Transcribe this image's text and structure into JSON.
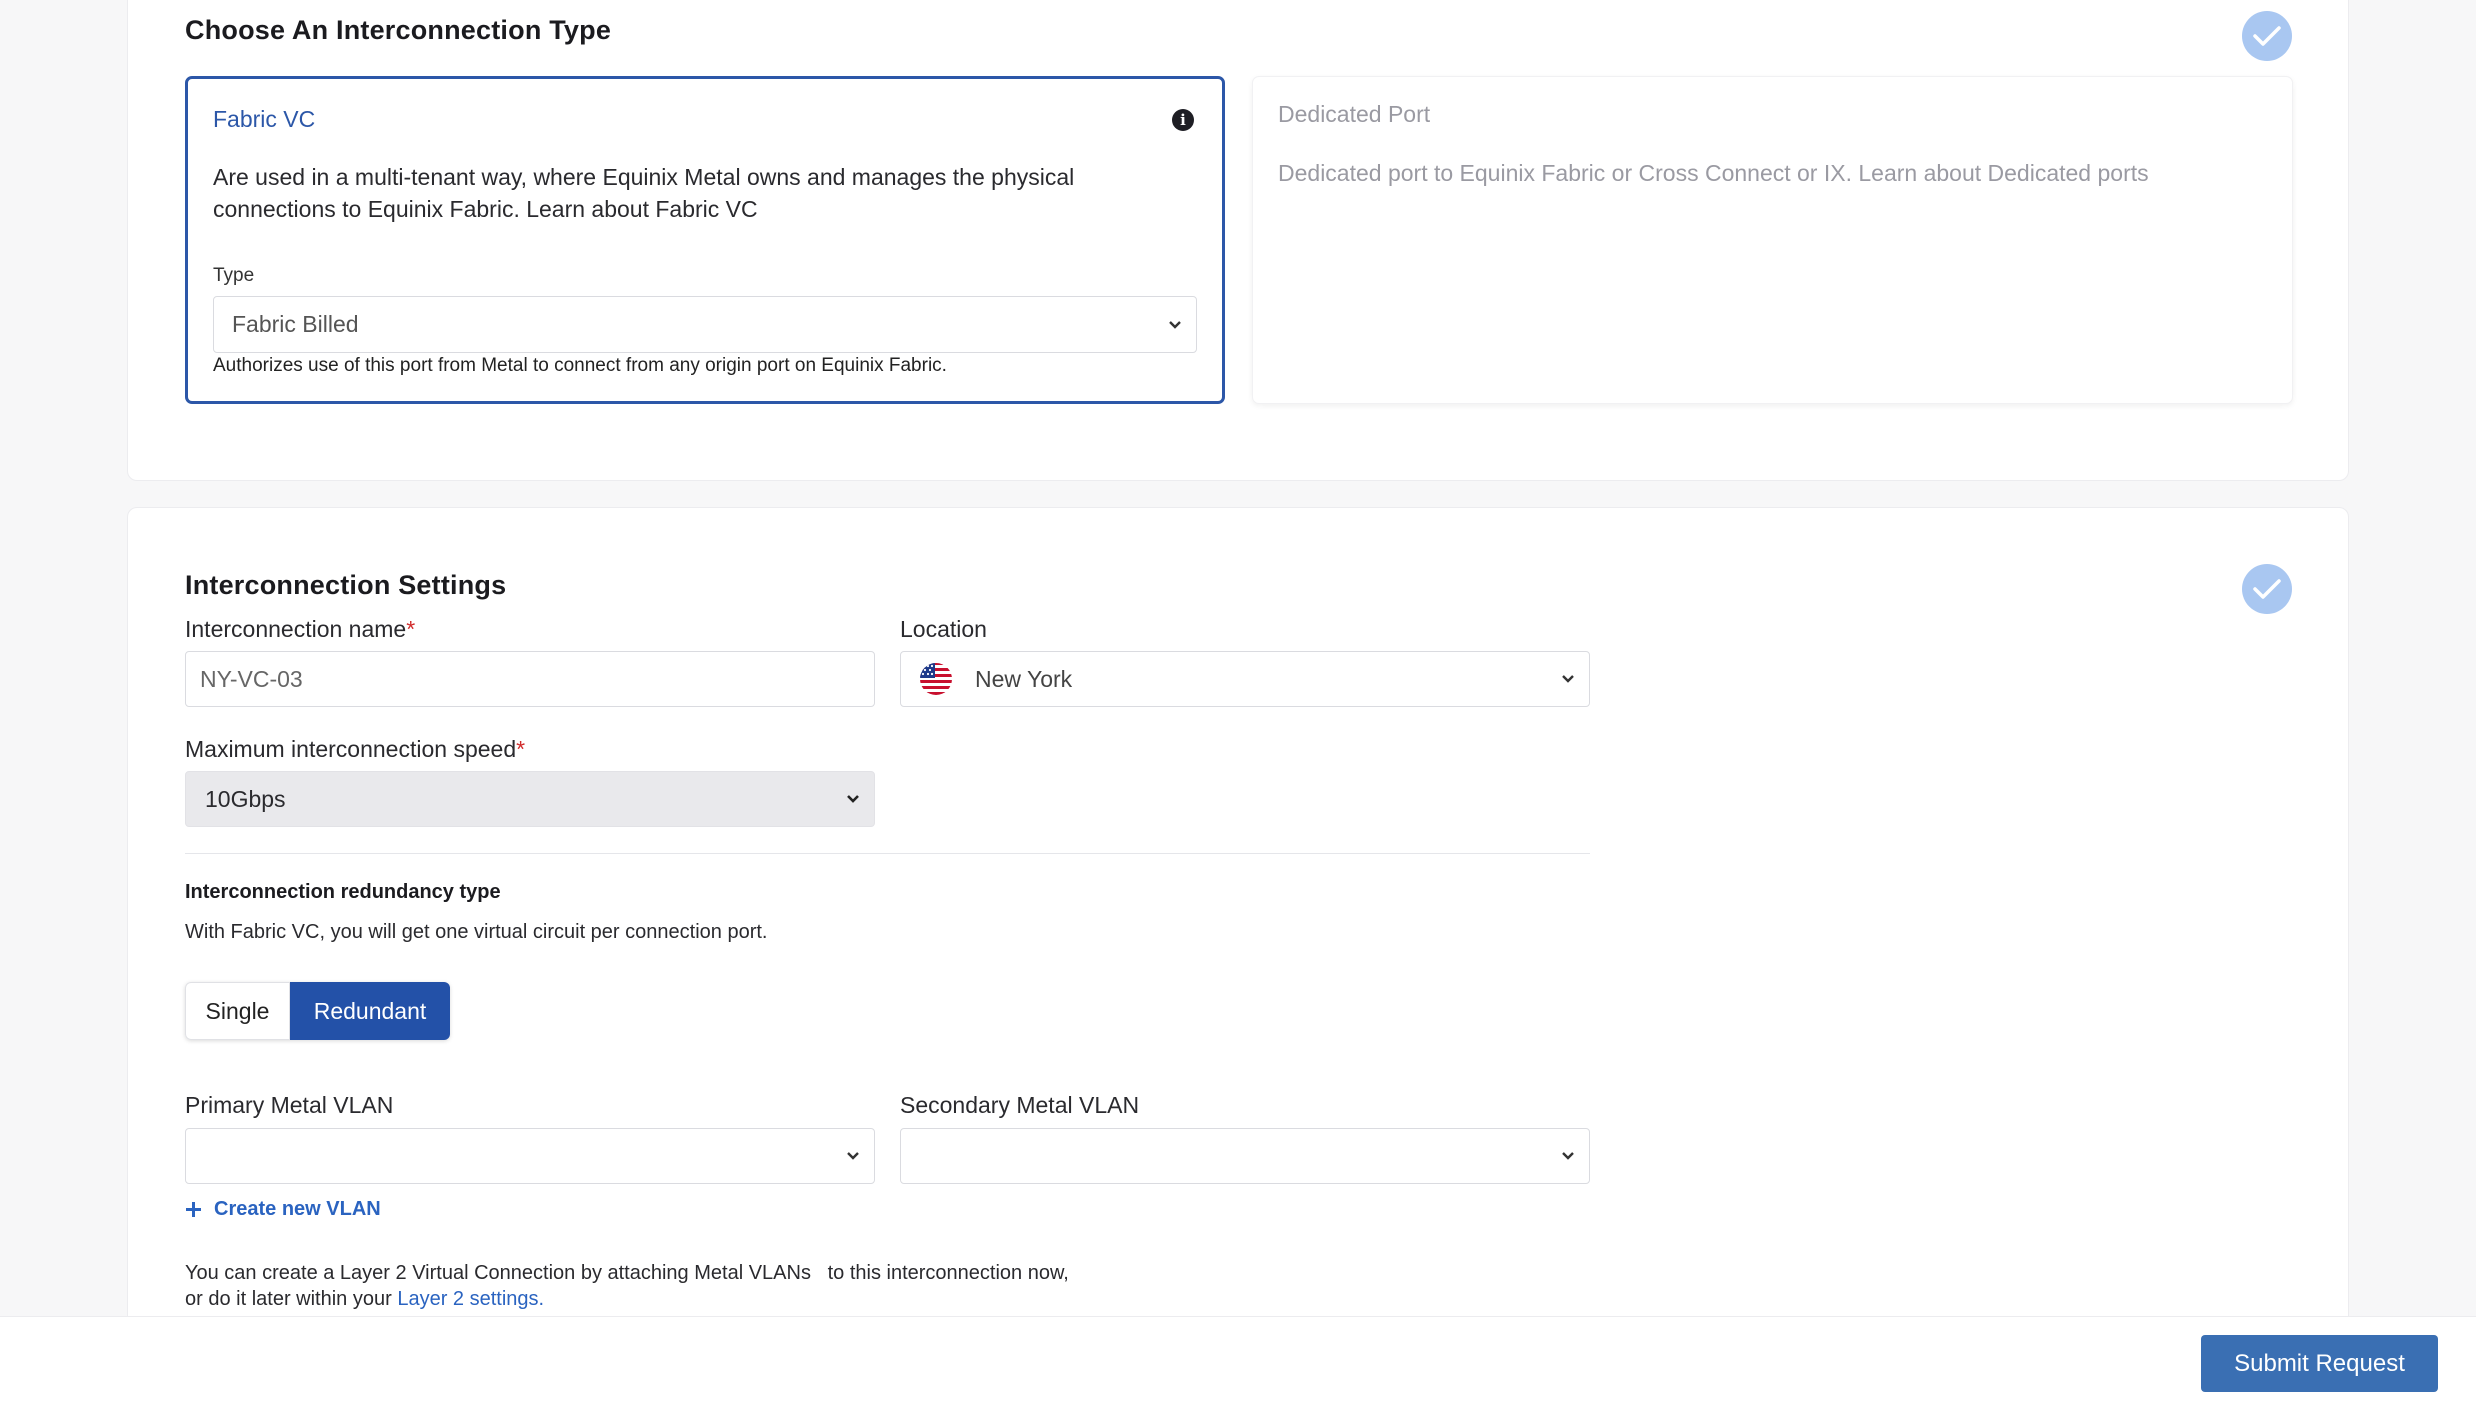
{
  "type_section": {
    "title": "Choose An Interconnection Type",
    "fabric_vc": {
      "title": "Fabric VC",
      "description": "Are used in a multi-tenant way, where Equinix Metal owns and manages the physical connections to Equinix Fabric. Learn about Fabric VC",
      "type_label": "Type",
      "type_value": "Fabric Billed",
      "type_help": "Authorizes use of this port from Metal to connect from any origin port on Equinix Fabric."
    },
    "dedicated_port": {
      "title": "Dedicated Port",
      "description": "Dedicated port to Equinix Fabric or Cross Connect or IX. Learn about Dedicated ports"
    }
  },
  "settings_section": {
    "title": "Interconnection Settings",
    "name_label": "Interconnection name",
    "name_value": "NY-VC-03",
    "location_label": "Location",
    "location_value": "New York",
    "speed_label": "Maximum interconnection speed",
    "speed_value": "10Gbps",
    "required_mark": "*",
    "redundancy_title": "Interconnection redundancy type",
    "redundancy_desc": "With Fabric VC, you will get one virtual circuit per connection port.",
    "redundancy_options": [
      "Single",
      "Redundant"
    ],
    "redundancy_selected": "Redundant",
    "primary_vlan_label": "Primary Metal VLAN",
    "secondary_vlan_label": "Secondary Metal VLAN",
    "primary_vlan_value": "",
    "secondary_vlan_value": "",
    "create_vlan_label": "Create new VLAN",
    "layer2_text_1": "You can create a Layer 2 Virtual Connection by attaching Metal VLANs   to this interconnection now,",
    "layer2_text_2": "or do it later within your",
    "layer2_link": "Layer 2 settings."
  },
  "footer": {
    "submit_label": "Submit Request"
  },
  "colors": {
    "accent": "#2351a8",
    "selected_border": "#2c57a8",
    "check_badge": "#a9c7f1",
    "link": "#2a63c0",
    "submit": "#3a6fb3"
  },
  "icons": [
    "check-icon",
    "info-icon",
    "chevron-down-icon",
    "us-flag-icon",
    "plus-icon"
  ]
}
